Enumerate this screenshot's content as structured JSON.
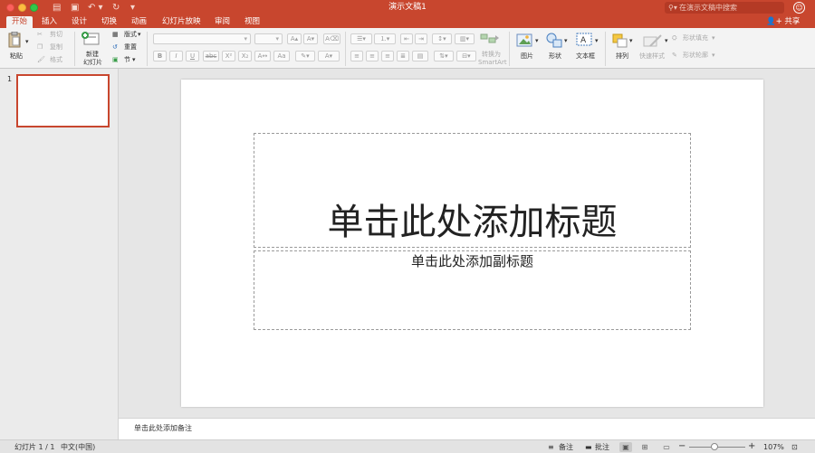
{
  "window": {
    "title": "演示文稿1"
  },
  "quick_access": {
    "icons": [
      "sidebar-toggle-icon",
      "save-icon",
      "undo-icon",
      "redo-icon",
      "customize-icon"
    ]
  },
  "search": {
    "placeholder": "在演示文稿中搜索"
  },
  "tabs": [
    "开始",
    "插入",
    "设计",
    "切换",
    "动画",
    "幻灯片放映",
    "审阅",
    "视图"
  ],
  "active_tab": "开始",
  "share": {
    "label": "共享"
  },
  "ribbon": {
    "paste": "粘贴",
    "cut": "剪切",
    "copy": "复制",
    "format": "格式",
    "new_slide_line1": "新建",
    "new_slide_line2": "幻灯片",
    "layout": "版式",
    "reset": "重置",
    "section": "节",
    "bold": "B",
    "italic": "I",
    "underline": "U",
    "strike": "abc",
    "superscript": "X²",
    "subscript": "X₂",
    "convert_line1": "转换为",
    "convert_line2": "SmartArt",
    "picture": "图片",
    "shape": "形状",
    "textbox": "文本框",
    "arrange": "排列",
    "quick_styles": "快速样式",
    "shape_fill": "形状填充",
    "shape_outline": "形状轮廓"
  },
  "thumbnails": [
    {
      "number": "1"
    }
  ],
  "slide": {
    "title_placeholder": "单击此处添加标题",
    "subtitle_placeholder": "单击此处添加副标题"
  },
  "notes": {
    "placeholder": "单击此处添加备注"
  },
  "status": {
    "slide_counter": "幻灯片 1 / 1",
    "language": "中文(中国)",
    "notes_button": "备注",
    "comments_button": "批注",
    "zoom": "107%",
    "zoom_fraction": 0.45
  },
  "colors": {
    "accent": "#c8462e"
  }
}
